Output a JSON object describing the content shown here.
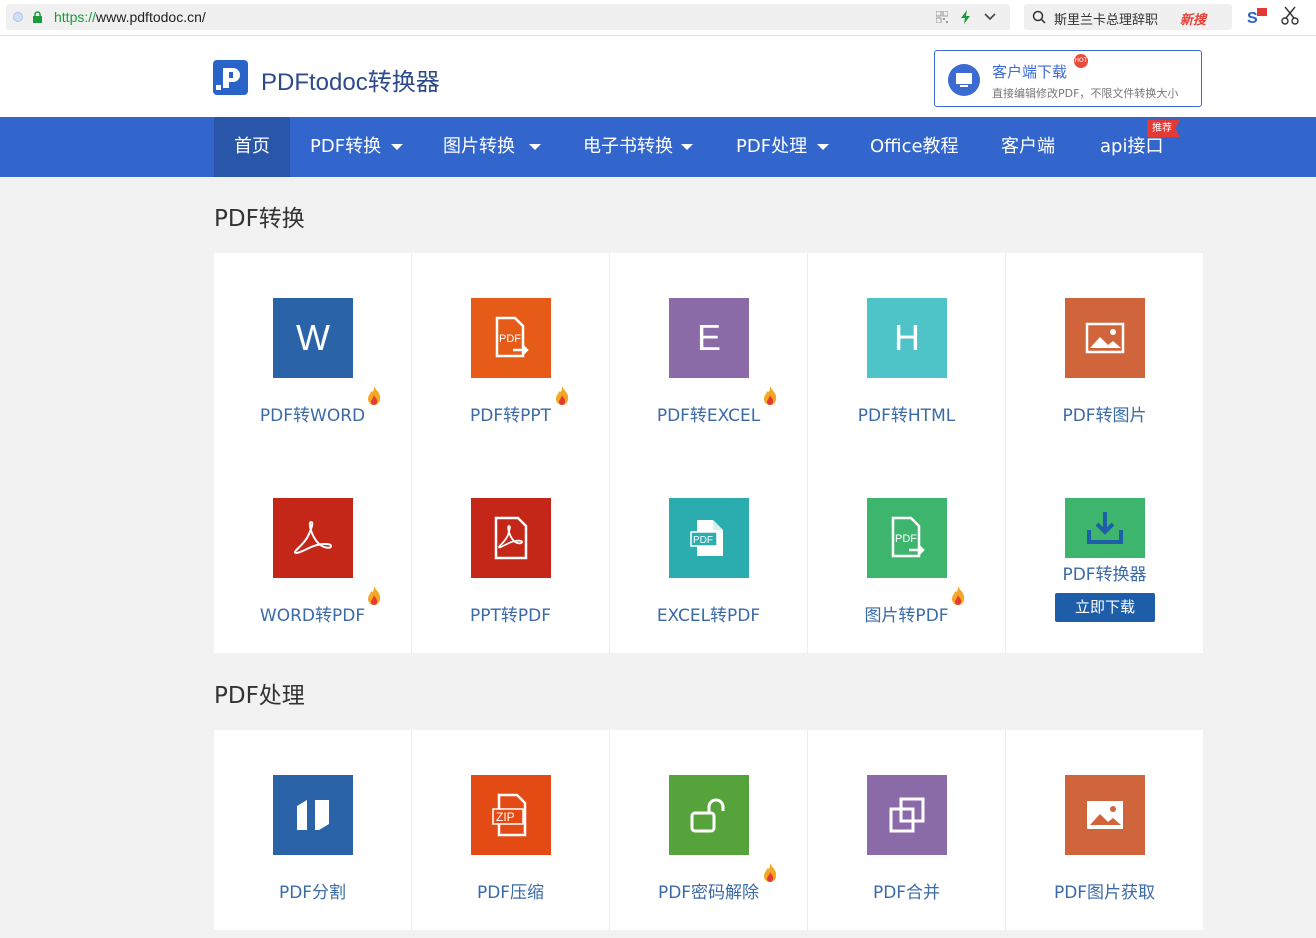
{
  "browser": {
    "url_scheme": "https://",
    "url_rest": "www.pdftodoc.cn/",
    "search_query": "斯里兰卡总理辞职",
    "search_hot_label": "新搜"
  },
  "header": {
    "logo_text": "PDFtodoc转换器",
    "download_title": "客户端下载",
    "download_sub": "直接编辑修改PDF，不限文件转换大小",
    "hot_tag": "HOT"
  },
  "nav": {
    "items": [
      {
        "label": "首页"
      },
      {
        "label": "PDF转换"
      },
      {
        "label": "图片转换"
      },
      {
        "label": "电子书转换"
      },
      {
        "label": "PDF处理"
      },
      {
        "label": "Office教程"
      },
      {
        "label": "客户端"
      },
      {
        "label": "api接口"
      }
    ],
    "badge": "推荐"
  },
  "section1": {
    "title": "PDF转换",
    "cells": [
      {
        "label": "PDF转WORD",
        "icon": "word-icon",
        "glyph": "W",
        "color": "#2a63a8"
      },
      {
        "label": "PDF转PPT",
        "icon": "pdf-ppt-icon",
        "color": "#e55b17"
      },
      {
        "label": "PDF转EXCEL",
        "icon": "excel-icon",
        "glyph": "E",
        "color": "#8b6aa8"
      },
      {
        "label": "PDF转HTML",
        "icon": "html-icon",
        "glyph": "H",
        "color": "#4ec4c8"
      },
      {
        "label": "PDF转图片",
        "icon": "image-icon",
        "color": "#d0643a"
      },
      {
        "label": "WORD转PDF",
        "icon": "acrobat-icon",
        "color": "#c42718"
      },
      {
        "label": "PPT转PDF",
        "icon": "acrobat-doc-icon",
        "color": "#c42718"
      },
      {
        "label": "EXCEL转PDF",
        "icon": "pdf-file-icon",
        "color": "#2bacae"
      },
      {
        "label": "图片转PDF",
        "icon": "pdf-export-icon",
        "color": "#3eb56d"
      },
      {
        "label": "PDF转换器",
        "icon": "download-icon",
        "color": "#3eb56d",
        "button": "立即下载"
      }
    ]
  },
  "section2": {
    "title": "PDF处理",
    "cells": [
      {
        "label": "PDF分割",
        "icon": "split-icon",
        "color": "#2a63a8"
      },
      {
        "label": "PDF压缩",
        "icon": "zip-icon",
        "glyph": "ZIP",
        "color": "#e34a14"
      },
      {
        "label": "PDF密码解除",
        "icon": "unlock-icon",
        "color": "#56a33c"
      },
      {
        "label": "PDF合并",
        "icon": "merge-icon",
        "color": "#8b6aa8"
      },
      {
        "label": "PDF图片获取",
        "icon": "image-icon",
        "color": "#d0643a"
      }
    ]
  }
}
